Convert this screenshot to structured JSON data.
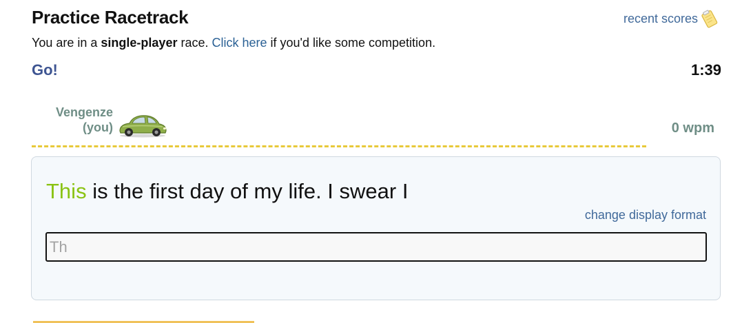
{
  "header": {
    "title": "Practice Racetrack",
    "recent_scores_label": "recent scores",
    "recent_scores_icon": "clipboard-icon"
  },
  "subtitle": {
    "prefix": "You are in a ",
    "mode": "single-player",
    "middle": " race. ",
    "link": "Click here",
    "suffix": " if you'd like some competition."
  },
  "status": {
    "go": "Go!",
    "timer": "1:39"
  },
  "racer": {
    "name": "Vengenze",
    "you_label": "(you)",
    "car_icon": "car-icon",
    "car_color": "#8fae4a",
    "wpm": "0 wpm"
  },
  "race": {
    "typed_word": "This",
    "remaining_text": " is the first day of my life. I swear I",
    "change_format_label": "change display format",
    "input_value": "Th"
  },
  "colors": {
    "typed_text": "#8ac313",
    "link": "#40699a",
    "go": "#3e5592",
    "track_line": "#e8c93a",
    "racer_text": "#6f8e86"
  }
}
